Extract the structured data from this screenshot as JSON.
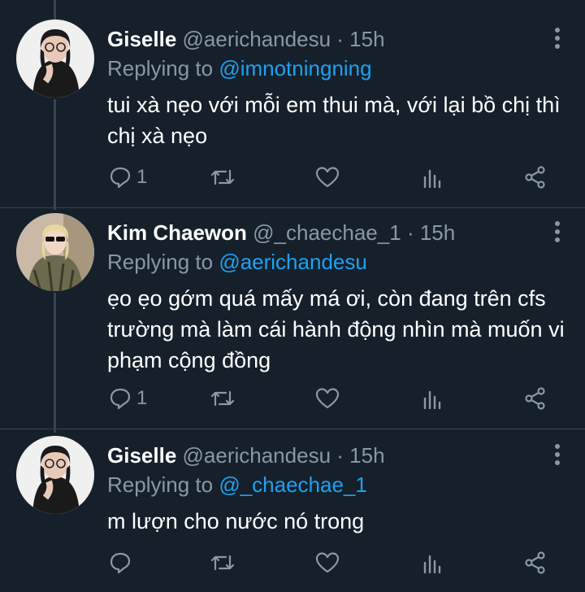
{
  "colors": {
    "background": "#15202b",
    "text": "#ffffff",
    "muted": "#8899a6",
    "link": "#1da1f2",
    "line": "#38444d"
  },
  "tweets": [
    {
      "name": "Giselle",
      "handle": "@aerichandesu",
      "dot": "·",
      "time": "15h",
      "replying_label": "Replying to",
      "replying_to": "@imnotningning",
      "text": "tui xà nẹo với mỗi em thui mà, với lại bồ chị thì chị xà nẹo",
      "reply_count": "1",
      "retweet_count": "",
      "like_count": ""
    },
    {
      "name": "Kim Chaewon",
      "handle": "@_chaechae_1",
      "dot": "·",
      "time": "15h",
      "replying_label": "Replying to",
      "replying_to": "@aerichandesu",
      "text": "ẹo ẹo gớm quá mấy má ơi, còn đang trên cfs trường mà làm cái hành động nhìn mà muốn vi phạm cộng đồng",
      "reply_count": "1",
      "retweet_count": "",
      "like_count": ""
    },
    {
      "name": "Giselle",
      "handle": "@aerichandesu",
      "dot": "·",
      "time": "15h",
      "replying_label": "Replying to",
      "replying_to": "@_chaechae_1",
      "text": "m lượn cho nước nó trong",
      "reply_count": "",
      "retweet_count": "",
      "like_count": ""
    }
  ]
}
